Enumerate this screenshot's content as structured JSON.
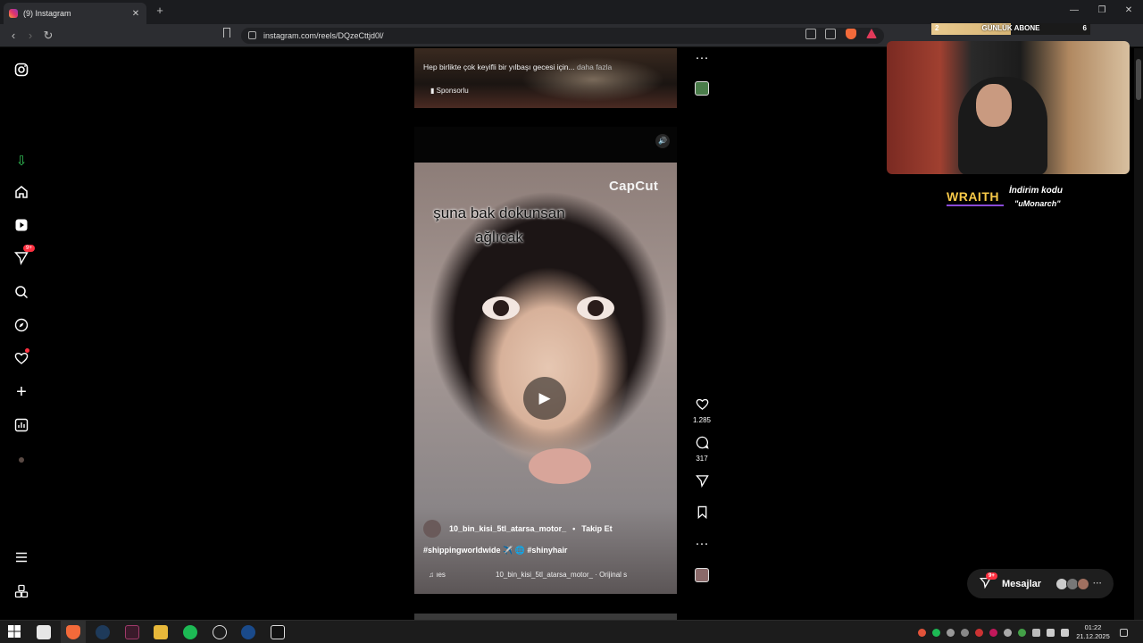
{
  "browser": {
    "tab_title": "(9) Instagram",
    "tab_close": "✕",
    "new_tab": "+",
    "url": "instagram.com/reels/DQzeCttjd0l/",
    "window_controls": {
      "minimize": "—",
      "restore": "❐",
      "close": "✕"
    }
  },
  "ig_nav": {
    "notifications_badge": "9+"
  },
  "previous_reel": {
    "caption": "Hep birlikte çok keyifli bir yılbaşı gecesi için...",
    "more": "daha fazla",
    "sponsored": "Sponsorlu"
  },
  "reel": {
    "watermark": "CapCut",
    "overlay_line1": "şuna bak dokunsan",
    "overlay_line2": "ağlıcak",
    "author": "10_bin_kisi_5tl_atarsa_motor_",
    "separator": "•",
    "follow": "Takip Et",
    "hashtags": "#shippingworldwide ✈️ 🌐 #shinyhair",
    "audio_left": "♫ ıes",
    "audio_right": "10_bin_kisi_5tl_atarsa_motor_ · Orijinal s"
  },
  "actions": {
    "likes": "1.285",
    "comments": "317",
    "more": "···"
  },
  "overlay": {
    "goal_left": "2",
    "goal_title": "GÜNLÜK ABONE",
    "goal_right": "6",
    "sponsor_brand": "WRAITH",
    "sponsor_line1": "İndirim kodu",
    "sponsor_line2": "\"uMonarch\""
  },
  "messages": {
    "label": "Mesajlar",
    "badge": "9+",
    "more": "···"
  },
  "taskbar": {
    "time": "01:22",
    "date": "21.12.2025"
  },
  "colors": {
    "instagram_red": "#ff3040",
    "goal_fill": "#e8c98e",
    "sponsor_yellow": "#f7c948"
  }
}
